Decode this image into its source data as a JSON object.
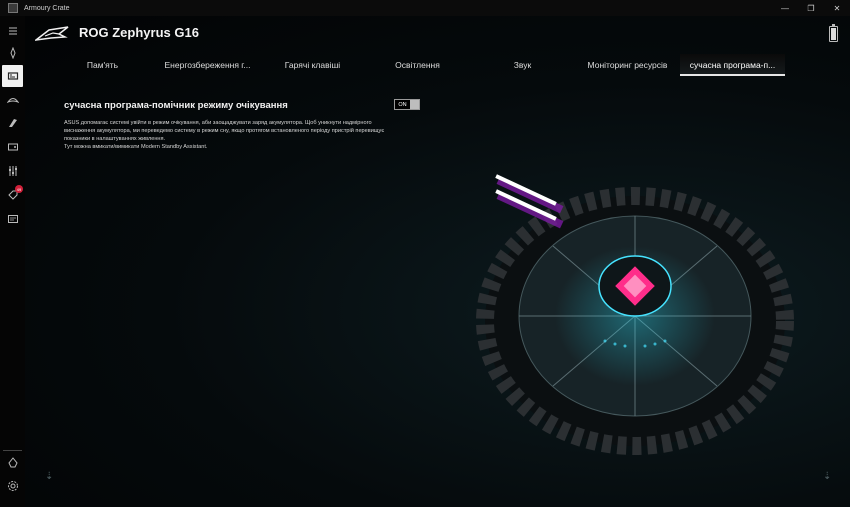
{
  "window": {
    "title": "Armoury Crate",
    "minimize_glyph": "—",
    "maximize_glyph": "❐",
    "close_glyph": "✕"
  },
  "header": {
    "device_name": "ROG Zephyrus G16",
    "logo_icon": "rog-eye-logo",
    "battery_level_percent": 90
  },
  "tabs": [
    {
      "label": "Пам'ять",
      "active": false
    },
    {
      "label": "Енергозбереження г...",
      "active": false
    },
    {
      "label": "Гарячі клавіші",
      "active": false
    },
    {
      "label": "Освітлення",
      "active": false
    },
    {
      "label": "Звук",
      "active": false
    },
    {
      "label": "Моніторинг ресурсів",
      "active": false
    },
    {
      "label": "сучасна програма-п...",
      "active": true
    }
  ],
  "section": {
    "title": "сучасна програма-помічник режиму очікування",
    "toggle_label": "ON",
    "description_lines": [
      "ASUS допомагає системі увійти в режим очікування, аби заощаджувати заряд акумулятора. Щоб уникнути надмірного",
      "виснаження акумулятора, ми переведемо систему в режим сну, якщо протягом встановленого періоду пристрій перевищує",
      "показники в налаштуваннях живлення.",
      "Тут можна вмикати/вимикати Modern Standby Assistant."
    ]
  },
  "sidebar": {
    "items": [
      "menu-icon",
      "rog-logo-icon",
      "device-icon",
      "aura-icon",
      "armoury-icon",
      "game-library-icon",
      "scenario-icon",
      "deals-icon",
      "news-icon"
    ],
    "badge": "49",
    "bottom": [
      "user-center-icon",
      "settings-icon"
    ]
  },
  "colors": {
    "accent_toggle": "#bdbdbd",
    "badge": "#d1203a",
    "art_core": "#ff2d8a",
    "art_glow": "#2ee6ff"
  }
}
